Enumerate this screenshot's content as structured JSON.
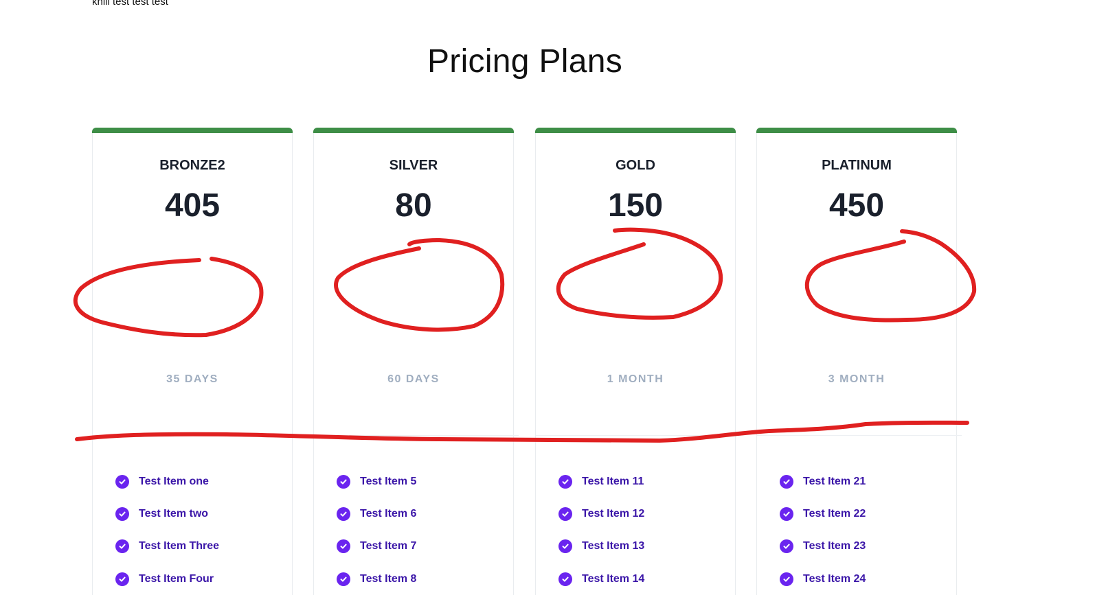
{
  "top_text": "khili test test test",
  "page_title": "Pricing Plans",
  "colors": {
    "card_bar": "#3e8e47",
    "check": "#6a24ef",
    "feature_text": "#3b16a8",
    "period_text": "#a0aec0",
    "annotation": "#e02020"
  },
  "icons": {
    "feature_check": "check-circle-icon"
  },
  "plans": [
    {
      "name": "BRONZE2",
      "price": "405",
      "period": "35 DAYS",
      "features": [
        "Test Item one",
        "Test Item two",
        "Test Item Three",
        "Test Item Four"
      ]
    },
    {
      "name": "SILVER",
      "price": "80",
      "period": "60 DAYS",
      "features": [
        "Test Item 5",
        "Test Item 6",
        "Test Item 7",
        "Test Item 8"
      ]
    },
    {
      "name": "GOLD",
      "price": "150",
      "period": "1 MONTH",
      "features": [
        "Test Item 11",
        "Test Item 12",
        "Test Item 13",
        "Test Item 14"
      ]
    },
    {
      "name": "PLATINUM",
      "price": "450",
      "period": "3 MONTH",
      "features": [
        "Test Item 21",
        "Test Item 22",
        "Test Item 23",
        "Test Item 24"
      ]
    }
  ]
}
